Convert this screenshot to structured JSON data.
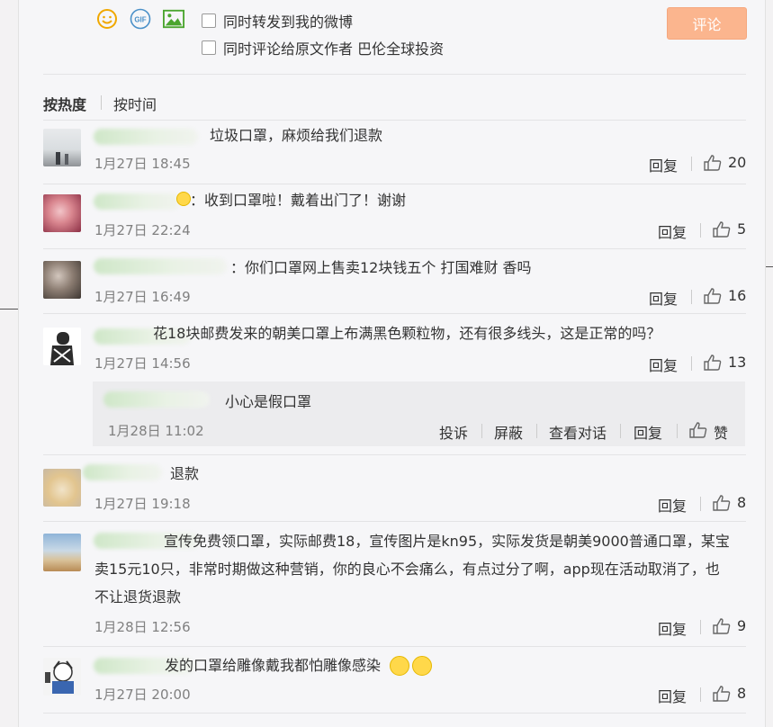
{
  "composer": {
    "icons": [
      "smile-icon",
      "gif-icon",
      "image-icon"
    ],
    "gif_label": "GIF",
    "option1": "同时转发到我的微博",
    "option2": "同时评论给原文作者 巴伦全球投资",
    "submit": "评论"
  },
  "sort": {
    "hot": "按热度",
    "time": "按时间"
  },
  "actions": {
    "reply": "回复",
    "report": "投诉",
    "block": "屏蔽",
    "view": "查看对话",
    "like": "赞"
  },
  "comments": [
    {
      "text": "垃圾口罩，麻烦给我们退款",
      "time": "1月27日 18:45",
      "likes": "20"
    },
    {
      "text": "：收到口罩啦！戴着出门了！谢谢",
      "time": "1月27日 22:24",
      "likes": "5"
    },
    {
      "text": "：你们口罩网上售卖12块钱五个 打国难财 香吗",
      "time": "1月27日 16:49",
      "likes": "16"
    },
    {
      "text": "花18块邮费发来的朝美口罩上布满黑色颗粒物，还有很多线头，这是正常的吗？",
      "time": "1月27日 14:56",
      "likes": "13"
    },
    {
      "text": "退款",
      "time": "1月27日 19:18",
      "likes": "8"
    },
    {
      "text_lines": [
        "宣传免费领口罩，实际邮费18，宣传图片是kn95，实际发货是朝美9000普通口罩，某宝",
        "卖15元10只，非常时期做这种营销，你的良心不会痛么，有点过分了啊，app现在活动取消了，也",
        "不让退货退款"
      ],
      "time": "1月28日 12:56",
      "likes": "9"
    },
    {
      "text": "发的口罩给雕像戴我都怕雕像感染",
      "time": "1月27日 20:00",
      "likes": "8"
    }
  ],
  "reply": {
    "text": "小心是假口罩",
    "time": "1月28日 11:02"
  },
  "colors": {
    "submit_bg": "#fbb58e",
    "name_green": "#cfe7c8"
  }
}
